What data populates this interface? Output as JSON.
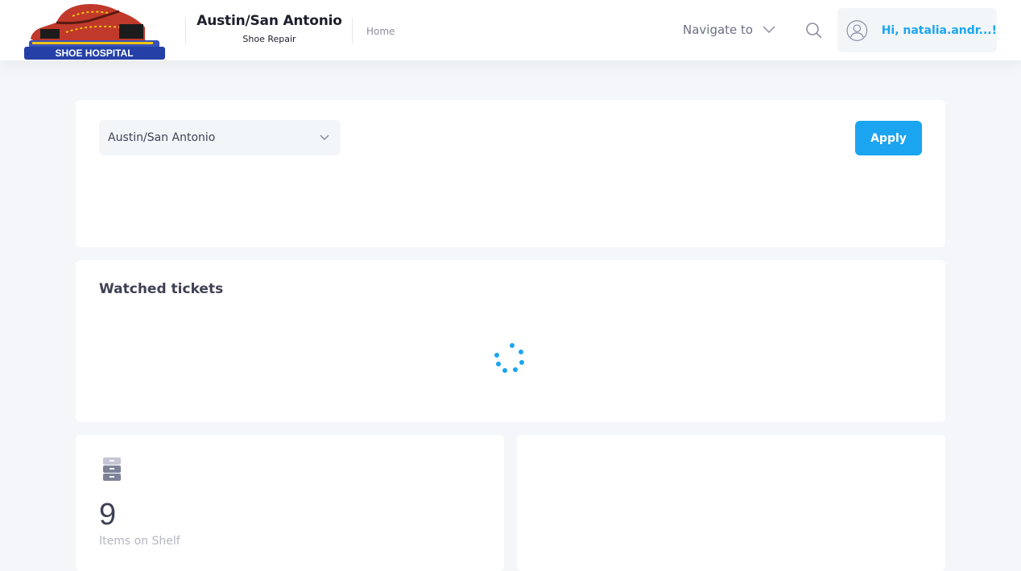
{
  "brand": {
    "logo_text": "SHOE HOSPITAL"
  },
  "header": {
    "store_name": "Austin/San Antonio",
    "store_subtitle": "Shoe Repair",
    "breadcrumb": "Home",
    "navigate_label": "Navigate to",
    "user_greeting": "Hi, natalia.andr...!"
  },
  "filter": {
    "location_value": "Austin/San Antonio",
    "apply_label": "Apply"
  },
  "watched": {
    "title": "Watched tickets"
  },
  "shelf": {
    "count": "9",
    "label": "Items on Shelf"
  },
  "colors": {
    "accent": "#1ba5f0",
    "background": "#f4f6f9"
  },
  "icons": [
    "shoe-logo",
    "chevron-down-icon",
    "search-icon",
    "user-avatar-icon",
    "loading-spinner-icon",
    "archive-icon"
  ]
}
